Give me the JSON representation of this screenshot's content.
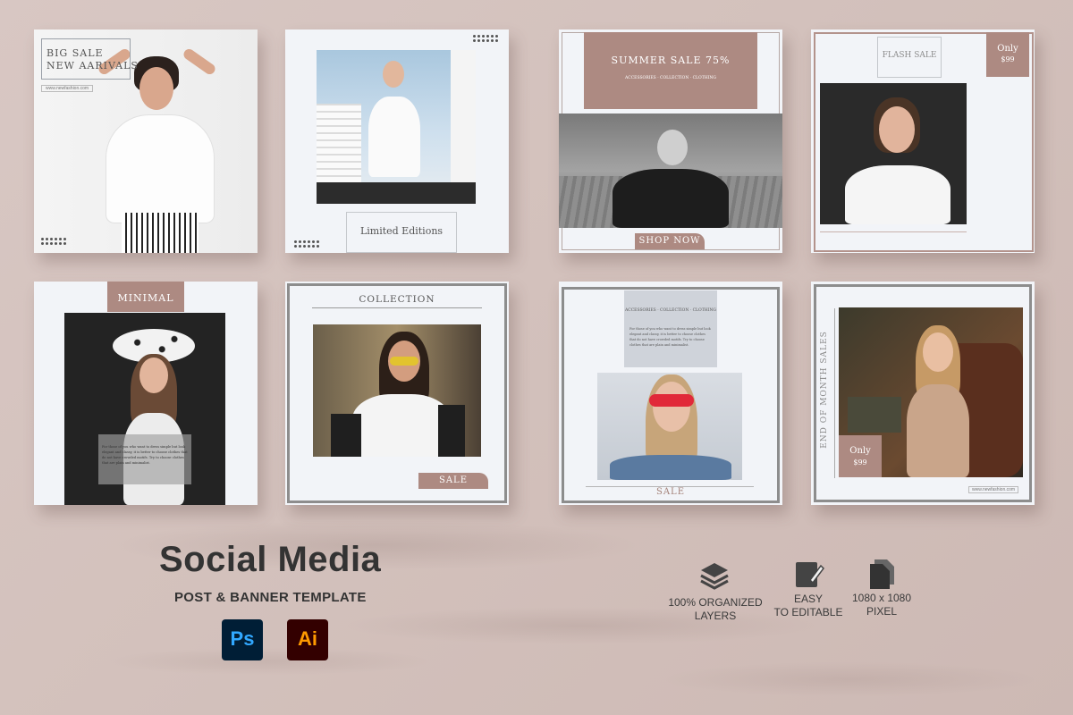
{
  "colors": {
    "accent": "#ad8a82",
    "background": "#d6c4c0",
    "card": "#f2f4f8",
    "ps": "#31a8ff",
    "ai": "#ff9a00"
  },
  "cards": {
    "c1": {
      "title_line1": "BIG SALE",
      "title_line2": "NEW AARIVALS",
      "url": "www.newfashion.com"
    },
    "c2": {
      "caption": "Limited Editions"
    },
    "c3": {
      "title": "SUMMER SALE 75%",
      "sub": "ACCESSORIES · COLLECTION · CLOTHING",
      "button": "SHOP NOW"
    },
    "c4": {
      "title": "FLASH SALE",
      "badge_top": "Only",
      "badge_price": "$99"
    },
    "c5": {
      "title": "MINIMAL",
      "body": "For those of you who want to dress simple but look elegant and classy, it is better to choose clothes that do not have crowded motifs. Try to choose clothes that are plain and minimalist."
    },
    "c6": {
      "title": "COLLECTION",
      "button": "SALE"
    },
    "c7": {
      "sub": "ACCESSORIES · COLLECTION · CLOTHING",
      "body": "For those of you who want to dress simple but look elegant and classy, it is better to choose clothes that do not have crowded motifs. Try to choose clothes that are plain and minimalist.",
      "caption": "SALE"
    },
    "c8": {
      "vertical": "END OF MONTH SALES",
      "badge_top": "Only",
      "badge_price": "$99",
      "url": "www.newfashion.com"
    }
  },
  "footer": {
    "title": "Social Media",
    "subtitle": "POST & BANNER TEMPLATE",
    "ps": "Ps",
    "ai": "Ai",
    "features": [
      {
        "icon": "layers-icon",
        "line1": "100% ORGANIZED",
        "line2": "LAYERS"
      },
      {
        "icon": "edit-icon",
        "line1": "EASY",
        "line2": "TO EDITABLE"
      },
      {
        "icon": "file-icon",
        "line1": "1080 x 1080",
        "line2": "PIXEL"
      }
    ]
  }
}
